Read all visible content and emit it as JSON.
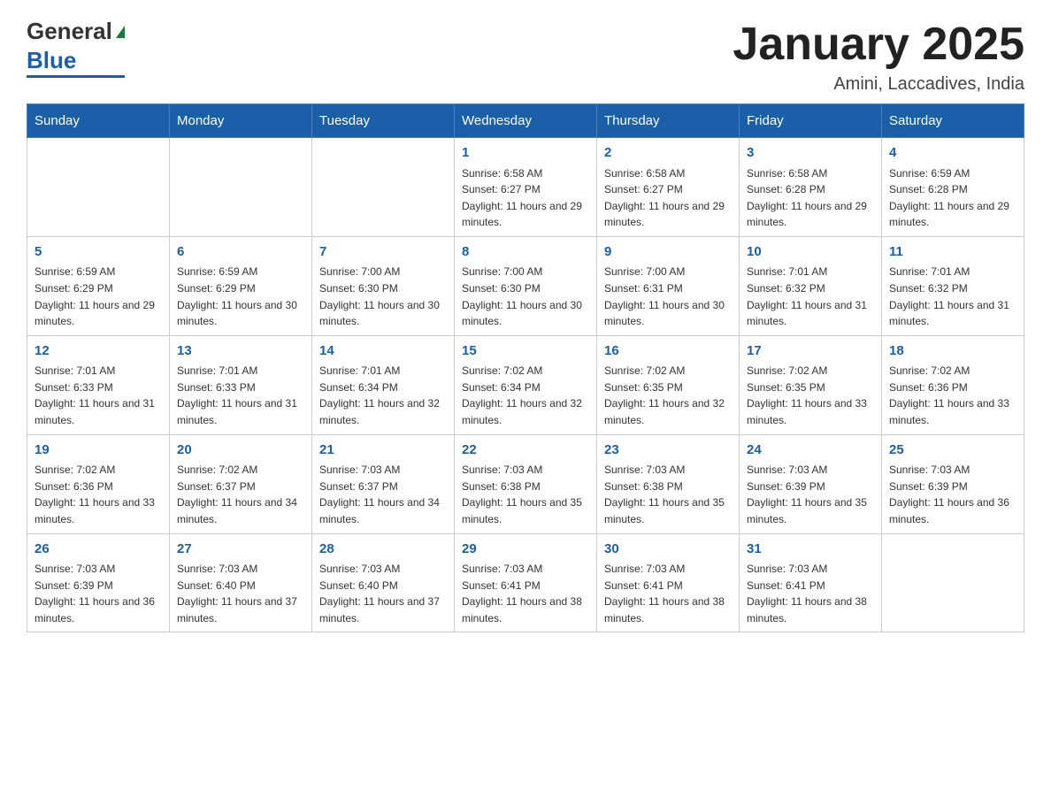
{
  "header": {
    "logo": {
      "general": "General",
      "blue": "Blue",
      "triangle_color": "#1a7a3a"
    },
    "title": "January 2025",
    "location": "Amini, Laccadives, India"
  },
  "weekdays": [
    "Sunday",
    "Monday",
    "Tuesday",
    "Wednesday",
    "Thursday",
    "Friday",
    "Saturday"
  ],
  "weeks": [
    [
      {
        "day": "",
        "info": ""
      },
      {
        "day": "",
        "info": ""
      },
      {
        "day": "",
        "info": ""
      },
      {
        "day": "1",
        "info": "Sunrise: 6:58 AM\nSunset: 6:27 PM\nDaylight: 11 hours and 29 minutes."
      },
      {
        "day": "2",
        "info": "Sunrise: 6:58 AM\nSunset: 6:27 PM\nDaylight: 11 hours and 29 minutes."
      },
      {
        "day": "3",
        "info": "Sunrise: 6:58 AM\nSunset: 6:28 PM\nDaylight: 11 hours and 29 minutes."
      },
      {
        "day": "4",
        "info": "Sunrise: 6:59 AM\nSunset: 6:28 PM\nDaylight: 11 hours and 29 minutes."
      }
    ],
    [
      {
        "day": "5",
        "info": "Sunrise: 6:59 AM\nSunset: 6:29 PM\nDaylight: 11 hours and 29 minutes."
      },
      {
        "day": "6",
        "info": "Sunrise: 6:59 AM\nSunset: 6:29 PM\nDaylight: 11 hours and 30 minutes."
      },
      {
        "day": "7",
        "info": "Sunrise: 7:00 AM\nSunset: 6:30 PM\nDaylight: 11 hours and 30 minutes."
      },
      {
        "day": "8",
        "info": "Sunrise: 7:00 AM\nSunset: 6:30 PM\nDaylight: 11 hours and 30 minutes."
      },
      {
        "day": "9",
        "info": "Sunrise: 7:00 AM\nSunset: 6:31 PM\nDaylight: 11 hours and 30 minutes."
      },
      {
        "day": "10",
        "info": "Sunrise: 7:01 AM\nSunset: 6:32 PM\nDaylight: 11 hours and 31 minutes."
      },
      {
        "day": "11",
        "info": "Sunrise: 7:01 AM\nSunset: 6:32 PM\nDaylight: 11 hours and 31 minutes."
      }
    ],
    [
      {
        "day": "12",
        "info": "Sunrise: 7:01 AM\nSunset: 6:33 PM\nDaylight: 11 hours and 31 minutes."
      },
      {
        "day": "13",
        "info": "Sunrise: 7:01 AM\nSunset: 6:33 PM\nDaylight: 11 hours and 31 minutes."
      },
      {
        "day": "14",
        "info": "Sunrise: 7:01 AM\nSunset: 6:34 PM\nDaylight: 11 hours and 32 minutes."
      },
      {
        "day": "15",
        "info": "Sunrise: 7:02 AM\nSunset: 6:34 PM\nDaylight: 11 hours and 32 minutes."
      },
      {
        "day": "16",
        "info": "Sunrise: 7:02 AM\nSunset: 6:35 PM\nDaylight: 11 hours and 32 minutes."
      },
      {
        "day": "17",
        "info": "Sunrise: 7:02 AM\nSunset: 6:35 PM\nDaylight: 11 hours and 33 minutes."
      },
      {
        "day": "18",
        "info": "Sunrise: 7:02 AM\nSunset: 6:36 PM\nDaylight: 11 hours and 33 minutes."
      }
    ],
    [
      {
        "day": "19",
        "info": "Sunrise: 7:02 AM\nSunset: 6:36 PM\nDaylight: 11 hours and 33 minutes."
      },
      {
        "day": "20",
        "info": "Sunrise: 7:02 AM\nSunset: 6:37 PM\nDaylight: 11 hours and 34 minutes."
      },
      {
        "day": "21",
        "info": "Sunrise: 7:03 AM\nSunset: 6:37 PM\nDaylight: 11 hours and 34 minutes."
      },
      {
        "day": "22",
        "info": "Sunrise: 7:03 AM\nSunset: 6:38 PM\nDaylight: 11 hours and 35 minutes."
      },
      {
        "day": "23",
        "info": "Sunrise: 7:03 AM\nSunset: 6:38 PM\nDaylight: 11 hours and 35 minutes."
      },
      {
        "day": "24",
        "info": "Sunrise: 7:03 AM\nSunset: 6:39 PM\nDaylight: 11 hours and 35 minutes."
      },
      {
        "day": "25",
        "info": "Sunrise: 7:03 AM\nSunset: 6:39 PM\nDaylight: 11 hours and 36 minutes."
      }
    ],
    [
      {
        "day": "26",
        "info": "Sunrise: 7:03 AM\nSunset: 6:39 PM\nDaylight: 11 hours and 36 minutes."
      },
      {
        "day": "27",
        "info": "Sunrise: 7:03 AM\nSunset: 6:40 PM\nDaylight: 11 hours and 37 minutes."
      },
      {
        "day": "28",
        "info": "Sunrise: 7:03 AM\nSunset: 6:40 PM\nDaylight: 11 hours and 37 minutes."
      },
      {
        "day": "29",
        "info": "Sunrise: 7:03 AM\nSunset: 6:41 PM\nDaylight: 11 hours and 38 minutes."
      },
      {
        "day": "30",
        "info": "Sunrise: 7:03 AM\nSunset: 6:41 PM\nDaylight: 11 hours and 38 minutes."
      },
      {
        "day": "31",
        "info": "Sunrise: 7:03 AM\nSunset: 6:41 PM\nDaylight: 11 hours and 38 minutes."
      },
      {
        "day": "",
        "info": ""
      }
    ]
  ]
}
